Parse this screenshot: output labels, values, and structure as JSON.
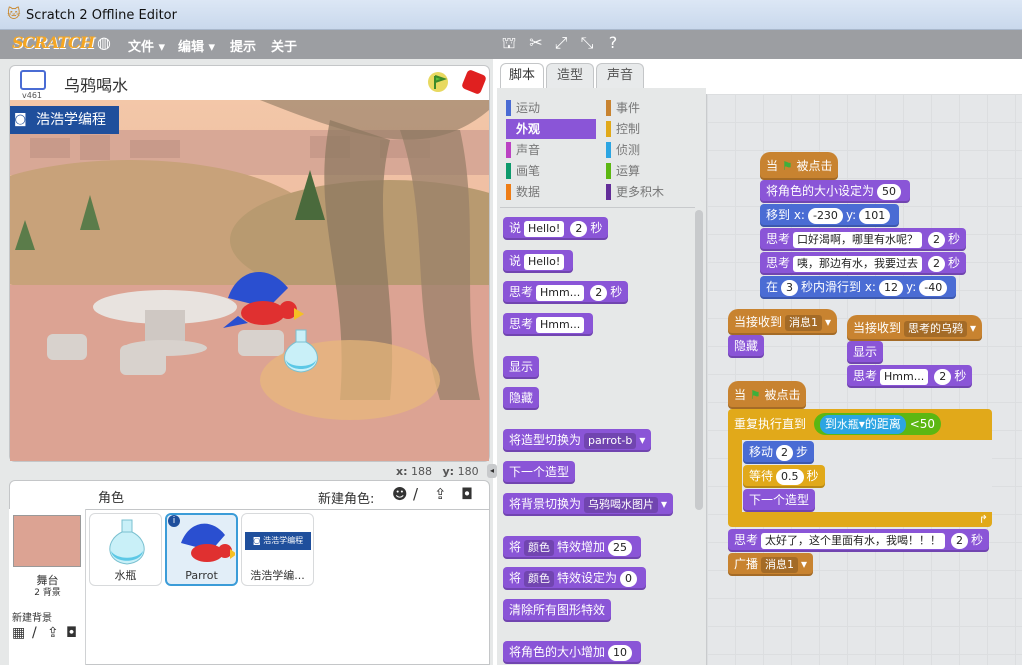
{
  "window": {
    "title": "Scratch 2 Offline Editor"
  },
  "menu": {
    "logo": "SCRATCH",
    "file": "文件 ▾",
    "edit": "编辑 ▾",
    "tips": "提示",
    "about": "关于"
  },
  "stage": {
    "project_title": "乌鸦喝水",
    "version": "v461",
    "banner": "浩浩学编程",
    "x_label": "x:",
    "x_value": "188",
    "y_label": "y:",
    "y_value": "180"
  },
  "tabs": [
    "脚本",
    "造型",
    "声音"
  ],
  "categories": [
    "运动",
    "外观",
    "声音",
    "画笔",
    "数据",
    "事件",
    "控制",
    "侦测",
    "运算",
    "更多积木"
  ],
  "palette": {
    "say_secs": [
      "说",
      "Hello!",
      "2",
      "秒"
    ],
    "say": [
      "说",
      "Hello!"
    ],
    "think_secs": [
      "思考",
      "Hmm...",
      "2",
      "秒"
    ],
    "think": [
      "思考",
      "Hmm..."
    ],
    "show": "显示",
    "hide": "隐藏",
    "switch_costume": [
      "将造型切换为",
      "parrot-b"
    ],
    "next_costume": "下一个造型",
    "switch_backdrop": [
      "将背景切换为",
      "乌鸦喝水图片"
    ],
    "change_effect": [
      "将",
      "颜色",
      "特效增加",
      "25"
    ],
    "set_effect": [
      "将",
      "颜色",
      "特效设定为",
      "0"
    ],
    "clear_effects": "清除所有图形特效",
    "change_size": [
      "将角色的大小增加",
      "10"
    ]
  },
  "sprites": {
    "header": "角色",
    "new_sprite": "新建角色:",
    "stage_label": "舞台",
    "stage_bg_count": "2 背景",
    "new_backdrop": "新建背景",
    "items": [
      "水瓶",
      "Parrot",
      "浩浩学编..."
    ]
  },
  "scripts": {
    "s1_hat": [
      "当",
      "被点击"
    ],
    "s1_size": [
      "将角色的大小设定为",
      "50"
    ],
    "s1_goto": [
      "移到 x:",
      "-230",
      "y:",
      "101"
    ],
    "s1_think1": [
      "思考",
      "口好渴啊，哪里有水呢？",
      "2",
      "秒"
    ],
    "s1_think2": [
      "思考",
      "咦，那边有水，我要过去",
      "2",
      "秒"
    ],
    "s1_glide": [
      "在",
      "3",
      "秒内滑行到 x:",
      "12",
      "y:",
      "-40"
    ],
    "s2_hat": [
      "当接收到",
      "消息1"
    ],
    "s2_hide": "隐藏",
    "s3_hat": [
      "当接收到",
      "思考的乌鸦"
    ],
    "s3_show": "显示",
    "s3_think": [
      "思考",
      "Hmm...",
      "2",
      "秒"
    ],
    "s4_hat": [
      "当",
      "被点击"
    ],
    "s4_repeat": [
      "重复执行直到",
      "到",
      "水瓶",
      "的距离",
      "<",
      "50"
    ],
    "s4_move": [
      "移动",
      "2",
      "步"
    ],
    "s4_wait": [
      "等待",
      "0.5",
      "秒"
    ],
    "s4_next": "下一个造型",
    "s4_think": [
      "思考",
      "太好了，这个里面有水，我喝！！！",
      "2",
      "秒"
    ],
    "s4_broadcast": [
      "广播",
      "消息1"
    ]
  },
  "colors": {
    "looks": "#8a55d7",
    "control": "#e1a91a",
    "events": "#c88330",
    "motion": "#4a6cd4",
    "sensing": "#2ca5e2"
  }
}
